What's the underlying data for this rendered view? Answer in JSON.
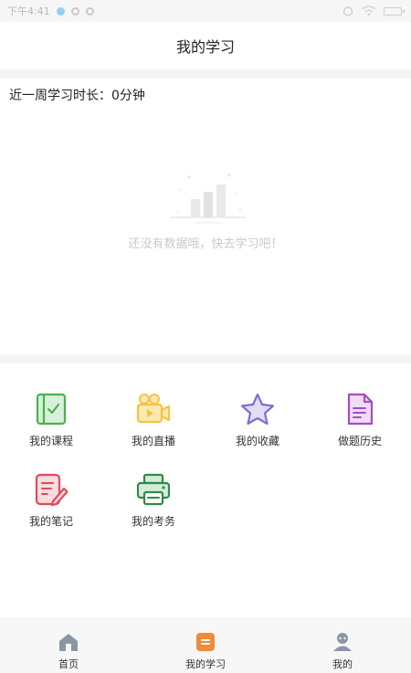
{
  "status_bar": {
    "time": "下午4:41"
  },
  "header": {
    "title": "我的学习"
  },
  "study": {
    "duration_label": "近一周学习时长：0分钟",
    "empty_message": "还没有数据哦，快去学习吧！"
  },
  "menu": {
    "items": [
      {
        "label": "我的课程",
        "icon": "course-book-icon",
        "color": "#4cb04f"
      },
      {
        "label": "我的直播",
        "icon": "live-camera-icon",
        "color": "#f2c447"
      },
      {
        "label": "我的收藏",
        "icon": "star-icon",
        "color": "#7d6fd0"
      },
      {
        "label": "做题历史",
        "icon": "document-icon",
        "color": "#a24fc0"
      },
      {
        "label": "我的笔记",
        "icon": "note-pen-icon",
        "color": "#e24a5b"
      },
      {
        "label": "我的考务",
        "icon": "printer-icon",
        "color": "#2f8a4a"
      }
    ]
  },
  "bottom_nav": {
    "items": [
      {
        "label": "首页",
        "icon": "home-icon",
        "active": false
      },
      {
        "label": "我的学习",
        "icon": "study-icon",
        "active": true
      },
      {
        "label": "我的",
        "icon": "profile-icon",
        "active": false
      }
    ],
    "active_color": "#f08a3c",
    "inactive_color": "#8a96a8"
  }
}
